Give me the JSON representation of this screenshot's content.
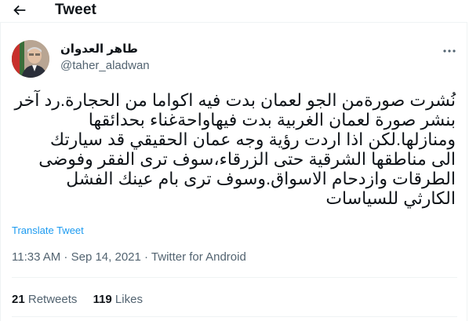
{
  "header": {
    "title": "Tweet",
    "back_icon": "arrow-left-icon"
  },
  "author": {
    "name": "طاهر العدوان",
    "handle": "@taher_aladwan",
    "avatar_icon": "profile-photo"
  },
  "more_icon": "more-horizontal-icon",
  "tweet": {
    "lines": [
      "نُشرت صورةمن الجو لعمان بدت فيه اكواما من الحجارة.رد آخر",
      "بنشر صورة لعمان الغربية بدت فيهاواحةغناء بحدائقها",
      "ومنازلها.لكن اذا اردت   رؤية وجه عمان الحقيقي قد سيارتك",
      "الى مناطقها الشرقية حتى الزرقاء،سوف ترى الفقر وفوضى",
      "الطرقات وازدحام الاسواق.وسوف ترى بام عينك الفشل",
      "الكارثي للسياسات"
    ]
  },
  "translate_label": "Translate Tweet",
  "meta": {
    "time": "11:33 AM",
    "separator": " · ",
    "date": "Sep 14, 2021",
    "source": "Twitter for Android"
  },
  "stats": {
    "retweets_count": "21",
    "retweets_label": " Retweets",
    "likes_count": "119",
    "likes_label": " Likes"
  },
  "colors": {
    "link": "#1d9bf0",
    "secondary": "#536471",
    "text": "#0f1419",
    "divider": "#eff3f4"
  }
}
